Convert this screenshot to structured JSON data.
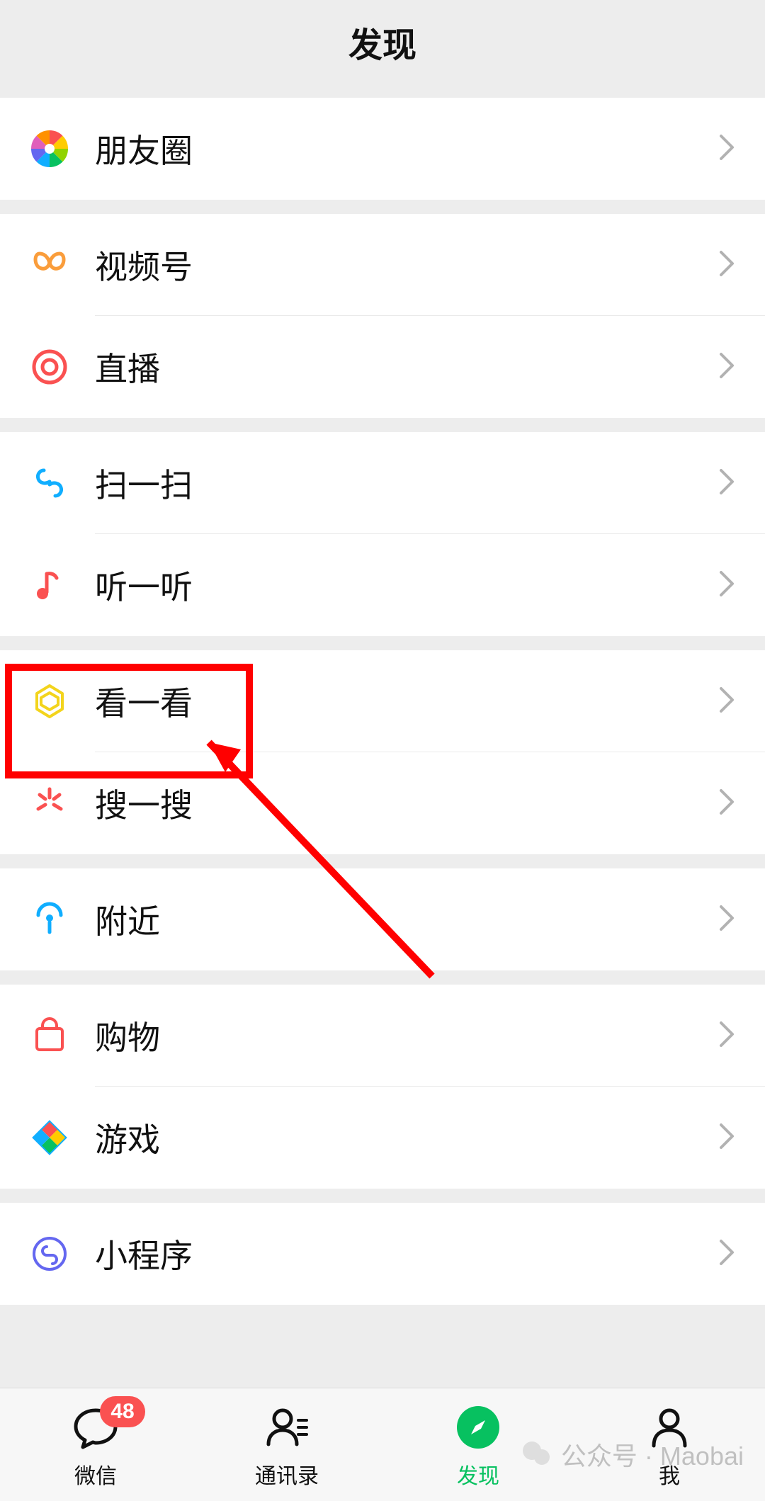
{
  "header": {
    "title": "发现"
  },
  "groups": [
    {
      "items": [
        {
          "key": "moments",
          "label": "朋友圈"
        }
      ]
    },
    {
      "items": [
        {
          "key": "channels",
          "label": "视频号"
        },
        {
          "key": "live",
          "label": "直播"
        }
      ]
    },
    {
      "items": [
        {
          "key": "scan",
          "label": "扫一扫"
        },
        {
          "key": "listen",
          "label": "听一听"
        }
      ]
    },
    {
      "items": [
        {
          "key": "topstories",
          "label": "看一看"
        },
        {
          "key": "search",
          "label": "搜一搜"
        }
      ]
    },
    {
      "items": [
        {
          "key": "nearby",
          "label": "附近"
        }
      ]
    },
    {
      "items": [
        {
          "key": "shopping",
          "label": "购物"
        },
        {
          "key": "games",
          "label": "游戏"
        }
      ]
    },
    {
      "items": [
        {
          "key": "miniprograms",
          "label": "小程序"
        }
      ]
    }
  ],
  "tabs": {
    "chats": {
      "label": "微信",
      "badge": "48"
    },
    "contacts": {
      "label": "通讯录"
    },
    "discover": {
      "label": "发现",
      "active": true
    },
    "me": {
      "label": "我"
    }
  },
  "annotation": {
    "highlight_target": "topstories",
    "highlight_color": "#ff0000"
  },
  "watermark": {
    "text": "公众号 · Maobai"
  }
}
